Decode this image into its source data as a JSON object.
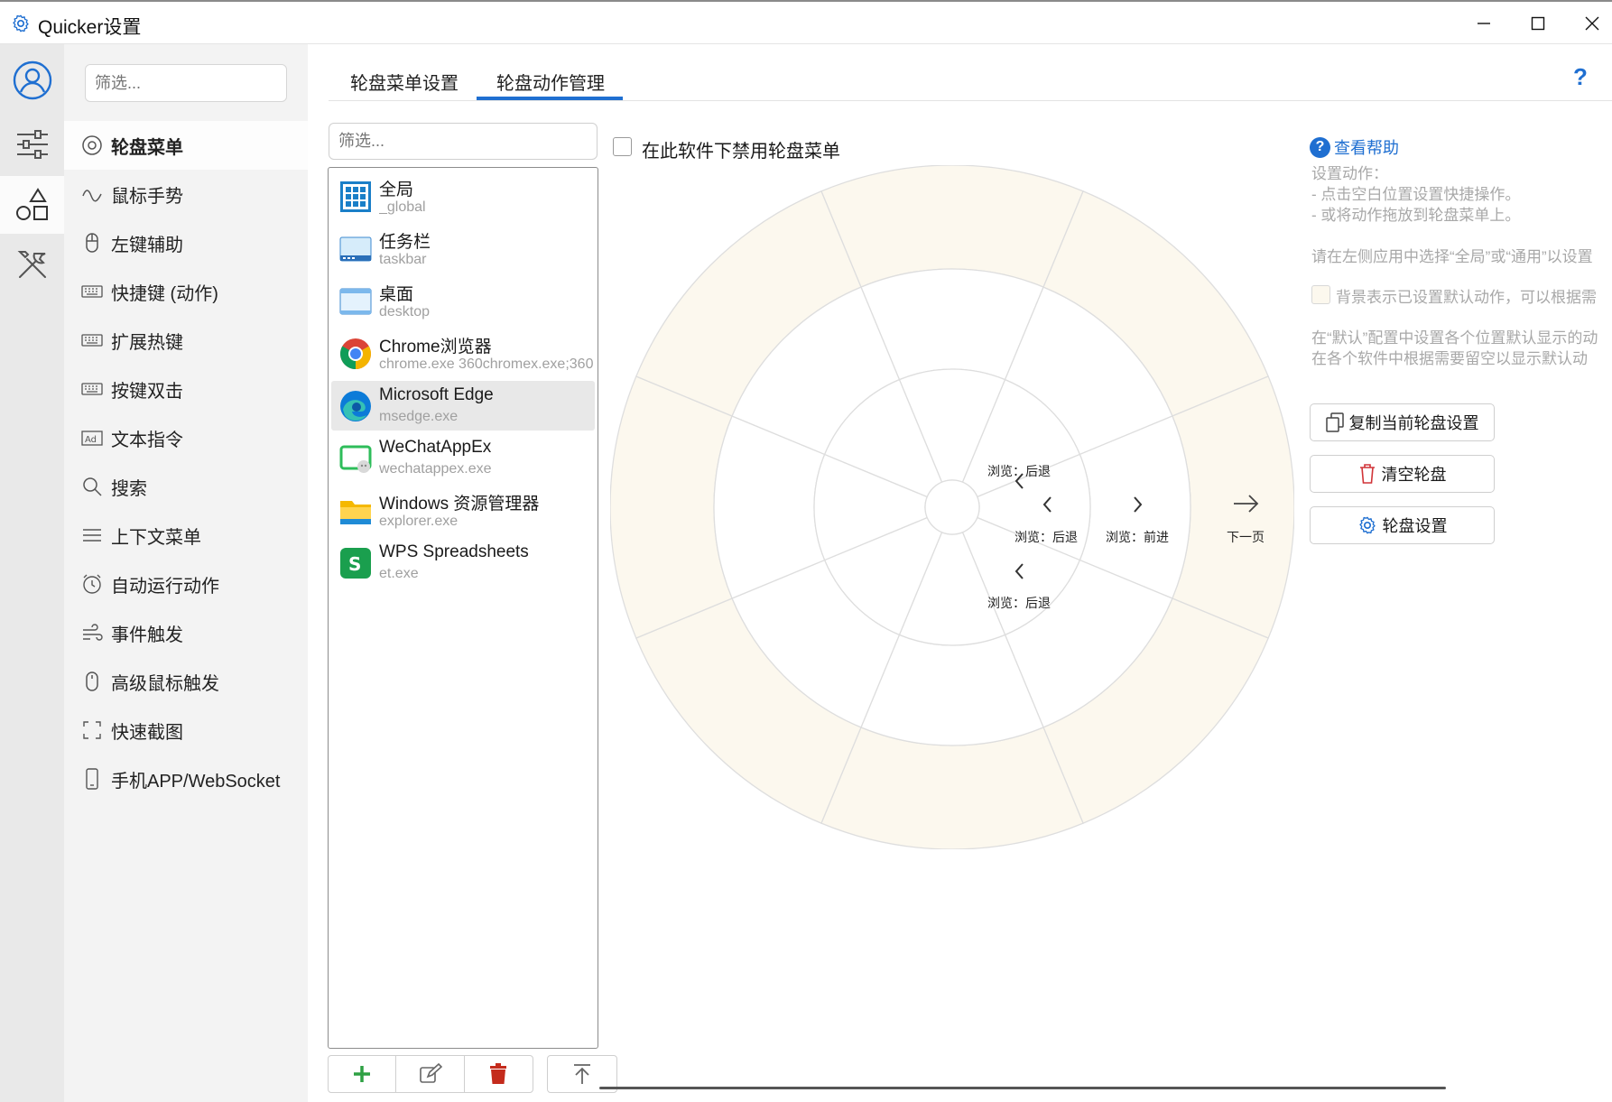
{
  "window": {
    "title": "Quicker设置"
  },
  "sidebar": {
    "search_placeholder": "筛选...",
    "items": [
      {
        "label": "轮盘菜单",
        "icon": "radio-circle-icon"
      },
      {
        "label": "鼠标手势",
        "icon": "gesture-wave-icon"
      },
      {
        "label": "左键辅助",
        "icon": "mouse-icon"
      },
      {
        "label": "快捷键 (动作)",
        "icon": "keyboard-icon"
      },
      {
        "label": "扩展热键",
        "icon": "keyboard-icon"
      },
      {
        "label": "按键双击",
        "icon": "keyboard-icon"
      },
      {
        "label": "文本指令",
        "icon": "ad-icon"
      },
      {
        "label": "搜索",
        "icon": "search-icon"
      },
      {
        "label": "上下文菜单",
        "icon": "menu-lines-icon"
      },
      {
        "label": "自动运行动作",
        "icon": "alarm-clock-icon"
      },
      {
        "label": "事件触发",
        "icon": "wind-icon"
      },
      {
        "label": "高级鼠标触发",
        "icon": "mouse-icon"
      },
      {
        "label": "快速截图",
        "icon": "screenshot-corners-icon"
      },
      {
        "label": "手机APP/WebSocket",
        "icon": "phone-icon"
      }
    ]
  },
  "tabs": [
    {
      "label": "轮盘菜单设置"
    },
    {
      "label": "轮盘动作管理"
    }
  ],
  "list": {
    "search_placeholder": "筛选...",
    "apps": [
      {
        "name": "全局",
        "exe": "_global",
        "icon": "global-grid-icon"
      },
      {
        "name": "任务栏",
        "exe": "taskbar",
        "icon": "taskbar-icon"
      },
      {
        "name": "桌面",
        "exe": "desktop",
        "icon": "desktop-icon"
      },
      {
        "name": "Chrome浏览器",
        "exe": "chrome.exe  360chromex.exe;360",
        "icon": "chrome-icon"
      },
      {
        "name": "Microsoft Edge",
        "exe": "msedge.exe",
        "icon": "edge-icon"
      },
      {
        "name": "WeChatAppEx",
        "exe": "wechatappex.exe",
        "icon": "wechat-app-icon"
      },
      {
        "name": "Windows 资源管理器",
        "exe": "explorer.exe",
        "icon": "folder-icon"
      },
      {
        "name": "WPS Spreadsheets",
        "exe": "et.exe",
        "icon": "wps-spreadsheet-icon"
      }
    ]
  },
  "main": {
    "disable_label": "在此软件下禁用轮盘菜单",
    "disable_checked": false,
    "wheel": {
      "actions": [
        {
          "label": "浏览：后退",
          "icon": "chevron-left-icon"
        },
        {
          "label": "浏览：后退",
          "icon": "chevron-left-icon"
        },
        {
          "label": "浏览：前进",
          "icon": "chevron-right-icon"
        },
        {
          "label": "浏览：后退",
          "icon": "chevron-left-icon"
        },
        {
          "label": "下一页",
          "icon": "arrow-right-icon"
        }
      ],
      "colors": {
        "outer_ring": "#fcf8ee",
        "line": "#dedede"
      }
    }
  },
  "info": {
    "help_link": "查看帮助",
    "lines": [
      "设置动作：",
      "- 点击空白位置设置快捷操作。",
      "- 或将动作拖放到轮盘菜单上。",
      "请在左侧应用中选择“全局”或“通用”以设置",
      "背景表示已设置默认动作，可以根据需",
      "在“默认”配置中设置各个位置默认显示的动",
      "在各个软件中根据需要留空以显示默认动"
    ],
    "buttons": [
      {
        "label": "复制当前轮盘设置",
        "icon": "copy-icon"
      },
      {
        "label": "清空轮盘",
        "icon": "trash-icon"
      },
      {
        "label": "轮盘设置",
        "icon": "gear-icon"
      }
    ]
  },
  "colors": {
    "accent": "#1f6fd1",
    "add": "#2ea043",
    "delete": "#c42b1c"
  }
}
